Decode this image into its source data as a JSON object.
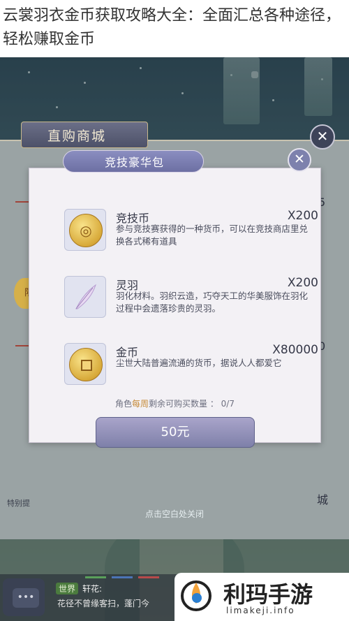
{
  "article": {
    "title": "云裳羽衣金币获取攻略大全：全面汇总各种途径，轻松赚取金币"
  },
  "shop": {
    "title": "直购商城",
    "close_symbol": "✕",
    "side_number_1": "5",
    "side_number_2": "0",
    "side_badge": "限",
    "left_label": "特别提",
    "right_label": "城"
  },
  "modal": {
    "title": "竞技豪华包",
    "close_symbol": "✕",
    "items": [
      {
        "name": "竞技币",
        "qty": "X200",
        "desc": "参与竞技赛获得的一种货币，可以在竞技商店里兑换各式稀有道具",
        "icon": "arena-coin-icon"
      },
      {
        "name": "灵羽",
        "qty": "X200",
        "desc": "羽化材料。羽织云造，巧夺天工的华美服饰在羽化过程中会遗落珍贵的灵羽。",
        "icon": "feather-icon"
      },
      {
        "name": "金币",
        "qty": "X80000",
        "desc": "尘世大陆普遍流通的货币，据说人人都爱它",
        "icon": "gold-coin-icon"
      }
    ],
    "limit_prefix": "角色",
    "limit_highlight": "每周",
    "limit_suffix": "剩余可购买数量 ： 0/7",
    "buy_label": "50元"
  },
  "close_hint": "点击空白处关闭",
  "chat": {
    "channel": "世界",
    "sender": "轩花:",
    "message": "花径不曾缘客扫，蓬门今"
  },
  "watermark": {
    "text": "利玛手游",
    "url": "limakeji.info"
  },
  "colors": {
    "modal_bg": "#f3f1f5",
    "button": "#8a8bb5",
    "highlight": "#c68b3a"
  }
}
